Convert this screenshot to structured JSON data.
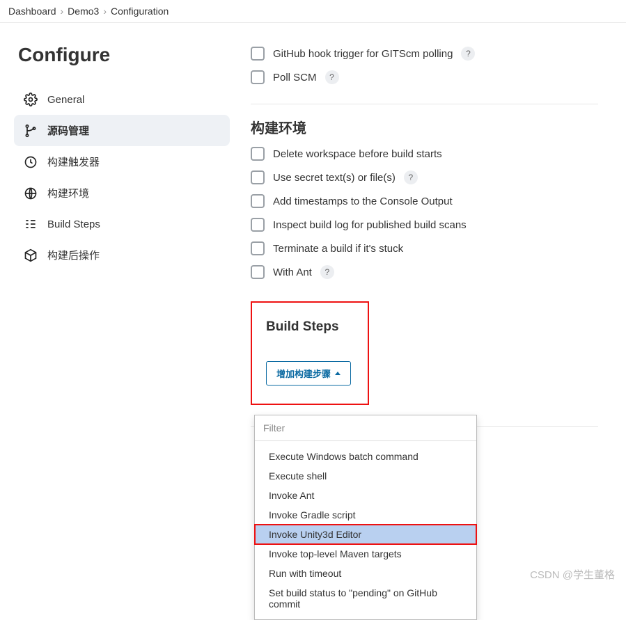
{
  "breadcrumb": {
    "items": [
      "Dashboard",
      "Demo3",
      "Configuration"
    ]
  },
  "page_title": "Configure",
  "sidebar": {
    "items": [
      {
        "label": "General"
      },
      {
        "label": "源码管理"
      },
      {
        "label": "构建触发器"
      },
      {
        "label": "构建环境"
      },
      {
        "label": "Build Steps"
      },
      {
        "label": "构建后操作"
      }
    ]
  },
  "triggers": {
    "items": [
      {
        "label": "GitHub hook trigger for GITScm polling",
        "help": true
      },
      {
        "label": "Poll SCM",
        "help": true
      }
    ]
  },
  "build_env": {
    "title": "构建环境",
    "items": [
      {
        "label": "Delete workspace before build starts",
        "help": false
      },
      {
        "label": "Use secret text(s) or file(s)",
        "help": true
      },
      {
        "label": "Add timestamps to the Console Output",
        "help": false
      },
      {
        "label": "Inspect build log for published build scans",
        "help": false
      },
      {
        "label": "Terminate a build if it's stuck",
        "help": false
      },
      {
        "label": "With Ant",
        "help": true
      }
    ]
  },
  "build_steps": {
    "title": "Build Steps",
    "add_button": "增加构建步骤",
    "filter_placeholder": "Filter",
    "options": [
      "Execute Windows batch command",
      "Execute shell",
      "Invoke Ant",
      "Invoke Gradle script",
      "Invoke Unity3d Editor",
      "Invoke top-level Maven targets",
      "Run with timeout",
      "Set build status to \"pending\" on GitHub commit"
    ],
    "highlighted_index": 4
  },
  "watermark": "CSDN @学生董格"
}
